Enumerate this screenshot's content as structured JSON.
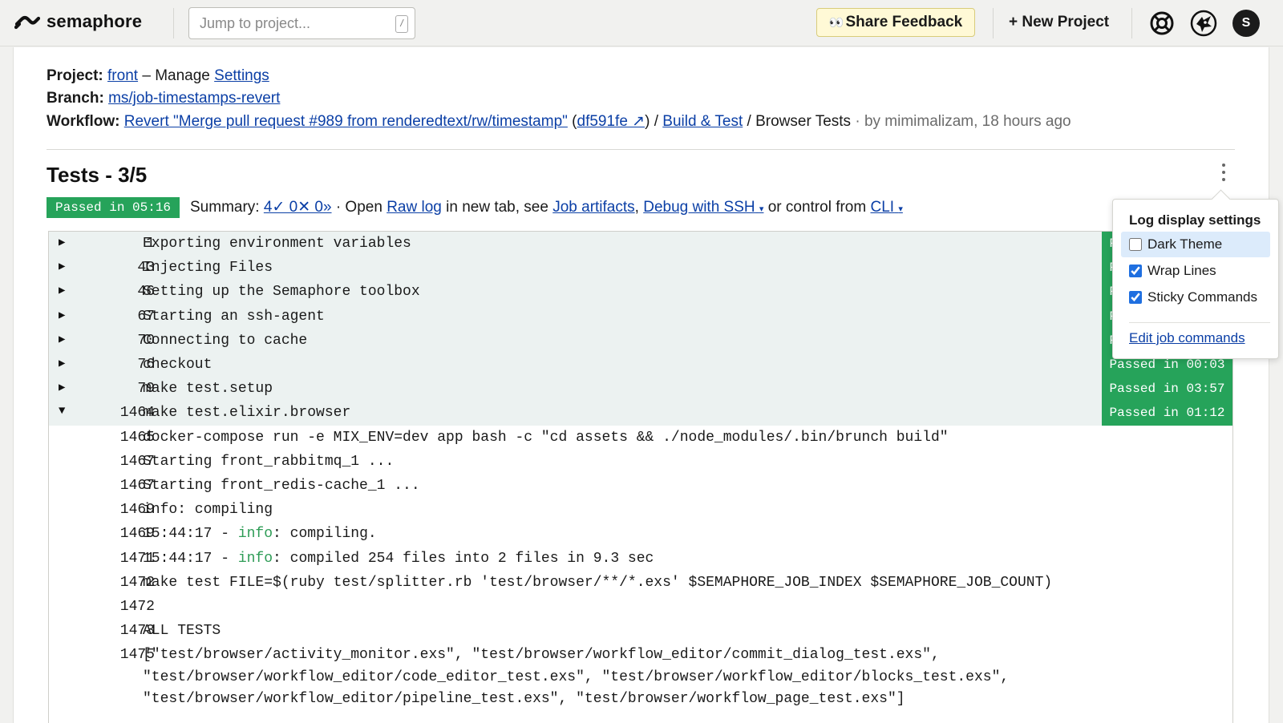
{
  "app": {
    "name": "semaphore"
  },
  "topbar": {
    "search_placeholder": "Jump to project...",
    "search_shortcut": "/",
    "feedback_label": "Share Feedback",
    "new_project_label": "+ New Project",
    "avatar_initial": "S",
    "icons": [
      "lifebuoy-icon",
      "alien-icon"
    ]
  },
  "project": {
    "label": "Project:",
    "name": "front",
    "separator": "– Manage",
    "settings_link": "Settings"
  },
  "branch": {
    "label": "Branch:",
    "name": "ms/job-timestamps-revert"
  },
  "workflow": {
    "label": "Workflow:",
    "name": "Revert \"Merge pull request #989 from renderedtext/rw/timestamp\"",
    "commit": "df591fe ↗",
    "pipeline": "Build & Test",
    "block": "/ Browser Tests",
    "author_info": "· by mimimalizam, 18 hours ago"
  },
  "job": {
    "title": "Tests - 3/5",
    "badge": "Passed in 05:16",
    "summary_label": "Summary:",
    "summary_counts": "4✓ 0✕ 0»",
    "open_text": "· Open",
    "raw_log_link": "Raw log",
    "new_tab_text": "in new tab, see",
    "artifacts_link": "Job artifacts",
    "comma": ",",
    "ssh_link": "Debug with SSH",
    "control_text": "or control from",
    "cli_link": "CLI",
    "caret": "▾"
  },
  "log": {
    "commands": [
      {
        "line": "1",
        "text": "Exporting environment variables",
        "status": "Passed in 00:00",
        "expanded": false
      },
      {
        "line": "43",
        "text": "Injecting Files",
        "status": "Passed in 00:00",
        "expanded": false
      },
      {
        "line": "46",
        "text": "Setting up the Semaphore toolbox",
        "status": "Passed in 00:01",
        "expanded": false
      },
      {
        "line": "67",
        "text": "Starting an ssh-agent",
        "status": "Passed in 00:00",
        "expanded": false
      },
      {
        "line": "70",
        "text": "Connecting to cache",
        "status": "Passed in 00:00",
        "expanded": false
      },
      {
        "line": "76",
        "text": "checkout",
        "status": "Passed in 00:03",
        "expanded": false
      },
      {
        "line": "79",
        "text": "make test.setup",
        "status": "Passed in 03:57",
        "expanded": false
      },
      {
        "line": "1464",
        "text": "make test.elixir.browser",
        "status": "Passed in 01:12",
        "expanded": true
      }
    ],
    "triangle_collapsed": "▶",
    "triangle_expanded": "▼",
    "output": [
      {
        "line": "1465",
        "text": "docker-compose run -e MIX_ENV=dev app bash -c \"cd assets && ./node_modules/.bin/brunch build\""
      },
      {
        "line": "1467",
        "text": "Starting front_rabbitmq_1 ..."
      },
      {
        "line": "1467",
        "text": "Starting front_redis-cache_1 ..."
      },
      {
        "line": "1469",
        "text": "info: compiling"
      },
      {
        "line": "1469",
        "pre": "15:44:17 - ",
        "hl": "info",
        "post": ": compiling."
      },
      {
        "line": "1471",
        "pre": "15:44:17 - ",
        "hl": "info",
        "post": ": compiled 254 files into 2 files in 9.3 sec"
      },
      {
        "line": "1472",
        "text": "make test FILE=$(ruby test/splitter.rb 'test/browser/**/*.exs' $SEMAPHORE_JOB_INDEX $SEMAPHORE_JOB_COUNT)"
      },
      {
        "line": "1472",
        "text": ""
      },
      {
        "line": "1473",
        "text": "ALL TESTS"
      },
      {
        "line": "1475",
        "text": "[\"test/browser/activity_monitor.exs\", \"test/browser/workflow_editor/commit_dialog_test.exs\","
      },
      {
        "line": "",
        "text": "\"test/browser/workflow_editor/code_editor_test.exs\", \"test/browser/workflow_editor/blocks_test.exs\","
      },
      {
        "line": "",
        "text": "\"test/browser/workflow_editor/pipeline_test.exs\", \"test/browser/workflow_page_test.exs\"]"
      }
    ]
  },
  "settings_popover": {
    "title": "Log display settings",
    "options": [
      {
        "label": "Dark Theme",
        "checked": false
      },
      {
        "label": "Wrap Lines",
        "checked": true
      },
      {
        "label": "Sticky Commands",
        "checked": true
      }
    ],
    "edit_link": "Edit job commands"
  },
  "colors": {
    "passed_green": "#26a35a",
    "link_blue": "#0b3fa6",
    "command_row_bg": "#ecf2f1",
    "info_green": "#2e9c56"
  }
}
